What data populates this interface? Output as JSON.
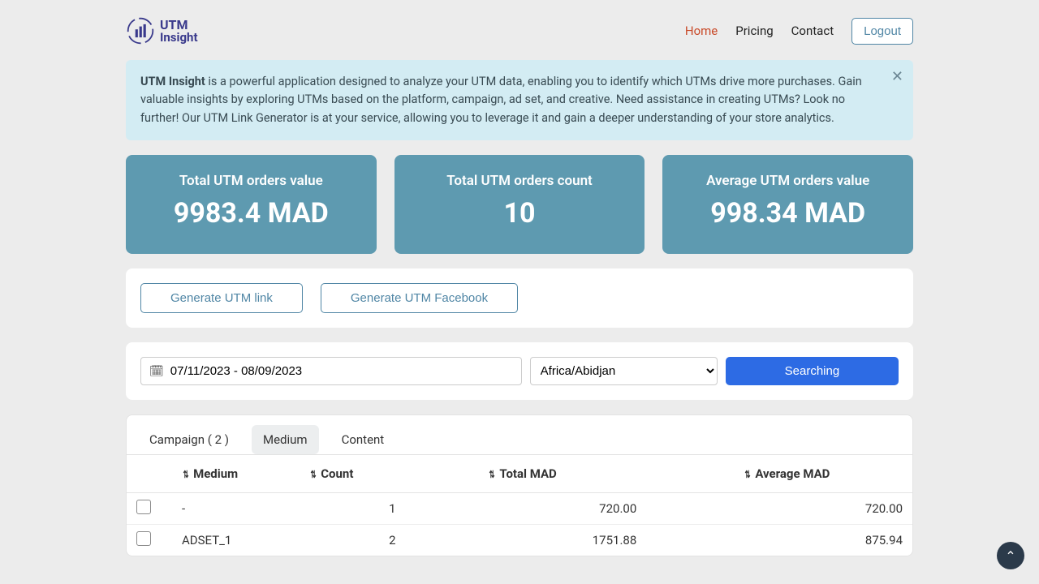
{
  "brand": {
    "line1": "UTM",
    "line2": "Insight"
  },
  "nav": {
    "home": "Home",
    "pricing": "Pricing",
    "contact": "Contact",
    "logout": "Logout"
  },
  "alert": {
    "strong": "UTM Insight",
    "text": " is a powerful application designed to analyze your UTM data, enabling you to identify which UTMs drive more purchases. Gain valuable insights by exploring UTMs based on the platform, campaign, ad set, and creative. Need assistance in creating UTMs? Look no further! Our UTM Link Generator is at your service, allowing you to leverage it and gain a deeper understanding of your store analytics."
  },
  "stats": [
    {
      "title": "Total UTM orders value",
      "value": "9983.4 MAD"
    },
    {
      "title": "Total UTM orders count",
      "value": "10"
    },
    {
      "title": "Average UTM orders value",
      "value": "998.34 MAD"
    }
  ],
  "buttons": {
    "gen_link": "Generate UTM link",
    "gen_fb": "Generate UTM Facebook",
    "search": "Searching"
  },
  "filters": {
    "date_range": "07/11/2023 - 08/09/2023",
    "timezone": "Africa/Abidjan"
  },
  "tabs": {
    "campaign": "Campaign ( 2 )",
    "medium": "Medium",
    "content": "Content"
  },
  "table": {
    "headers": {
      "medium": "Medium",
      "count": "Count",
      "total": "Total MAD",
      "average": "Average MAD"
    },
    "rows": [
      {
        "medium": "-",
        "count": "1",
        "total": "720.00",
        "average": "720.00"
      },
      {
        "medium": "ADSET_1",
        "count": "2",
        "total": "1751.88",
        "average": "875.94"
      }
    ]
  }
}
